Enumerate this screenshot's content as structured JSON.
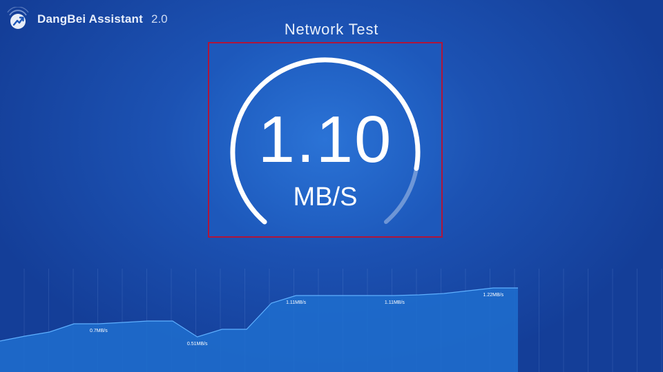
{
  "app": {
    "name": "DangBei Assistant",
    "version": "2.0",
    "logo_icon": "speed-arrow-icon"
  },
  "page": {
    "title": "Network Test"
  },
  "gauge": {
    "value": "1.10",
    "unit": "MB/S",
    "fill_fraction": 0.86
  },
  "colors": {
    "accent": "#ffffff",
    "panel_border": "#b0153a",
    "chart_fill": "#1f6fcf"
  },
  "chart_data": {
    "type": "area",
    "labels": [
      "0.7MB/s",
      "0.51MB/s",
      "1.11MB/s",
      "1.11MB/s",
      "1.22MB/s"
    ],
    "label_x_index": [
      4,
      8,
      12,
      16,
      20
    ],
    "values": [
      0.45,
      0.52,
      0.58,
      0.7,
      0.7,
      0.72,
      0.74,
      0.74,
      0.51,
      0.62,
      0.62,
      1.0,
      1.11,
      1.11,
      1.11,
      1.11,
      1.11,
      1.12,
      1.14,
      1.18,
      1.22,
      1.22
    ],
    "ylim": [
      0,
      1.6
    ],
    "grid": true
  }
}
